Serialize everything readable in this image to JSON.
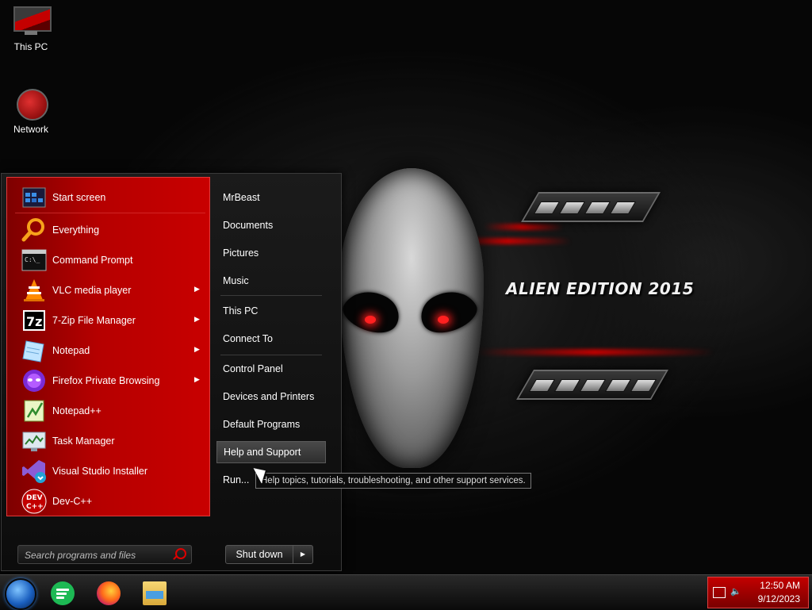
{
  "desktop": {
    "icons": [
      {
        "label": "This PC"
      },
      {
        "label": "Network"
      }
    ],
    "wallpaper_title": "ALIEN EDITION 2015"
  },
  "start_menu": {
    "programs": [
      {
        "label": "Start screen",
        "icon": "start-screen-icon",
        "has_submenu": false
      },
      {
        "label": "Everything",
        "icon": "magnifier-icon",
        "has_submenu": false
      },
      {
        "label": "Command Prompt",
        "icon": "terminal-icon",
        "has_submenu": false
      },
      {
        "label": "VLC media player",
        "icon": "vlc-cone-icon",
        "has_submenu": true
      },
      {
        "label": "7-Zip File Manager",
        "icon": "7zip-icon",
        "has_submenu": true
      },
      {
        "label": "Notepad",
        "icon": "notepad-icon",
        "has_submenu": true
      },
      {
        "label": "Firefox Private Browsing",
        "icon": "firefox-private-icon",
        "has_submenu": true
      },
      {
        "label": "Notepad++",
        "icon": "notepadpp-icon",
        "has_submenu": false
      },
      {
        "label": "Task Manager",
        "icon": "task-manager-icon",
        "has_submenu": false
      },
      {
        "label": "Visual Studio Installer",
        "icon": "vs-installer-icon",
        "has_submenu": false
      },
      {
        "label": "Dev-C++",
        "icon": "devcpp-icon",
        "has_submenu": false
      }
    ],
    "right_links": [
      {
        "label": "MrBeast"
      },
      {
        "label": "Documents"
      },
      {
        "label": "Pictures"
      },
      {
        "label": "Music"
      },
      {
        "label": "This PC"
      },
      {
        "label": "Connect To"
      },
      {
        "label": "Control Panel"
      },
      {
        "label": "Devices and Printers"
      },
      {
        "label": "Default Programs"
      },
      {
        "label": "Help and Support",
        "highlighted": true
      },
      {
        "label": "Run..."
      }
    ],
    "search_placeholder": "Search programs and files",
    "shutdown_label": "Shut down",
    "tooltip": "Help topics, tutorials, troubleshooting, and other support services."
  },
  "taskbar": {
    "apps": [
      "chat-app-icon",
      "firefox-icon",
      "file-explorer-icon"
    ],
    "time": "12:50 AM",
    "date": "9/12/2023"
  },
  "colors": {
    "accent_red": "#c80000",
    "tray_red": "#b00000",
    "eye_glow": "#ff2020"
  }
}
